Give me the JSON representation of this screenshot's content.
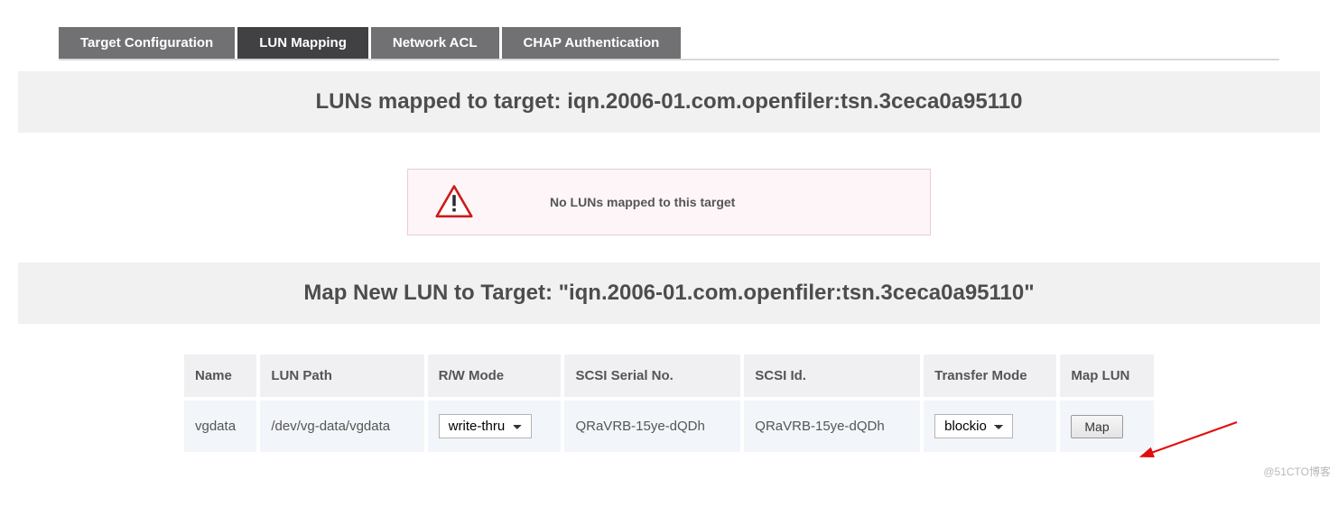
{
  "tabs": [
    {
      "label": "Target Configuration",
      "active": false
    },
    {
      "label": "LUN Mapping",
      "active": true
    },
    {
      "label": "Network ACL",
      "active": false
    },
    {
      "label": "CHAP Authentication",
      "active": false
    }
  ],
  "section1": {
    "title": "LUNs mapped to target: iqn.2006-01.com.openfiler:tsn.3ceca0a95110"
  },
  "notice": {
    "text": "No LUNs mapped to this target"
  },
  "section2": {
    "title": "Map New LUN to Target: \"iqn.2006-01.com.openfiler:tsn.3ceca0a95110\""
  },
  "lun_table": {
    "headers": {
      "name": "Name",
      "lun_path": "LUN Path",
      "rw_mode": "R/W Mode",
      "scsi_serial": "SCSI Serial No.",
      "scsi_id": "SCSI Id.",
      "transfer_mode": "Transfer Mode",
      "map_lun": "Map LUN"
    },
    "row": {
      "name": "vgdata",
      "lun_path": "/dev/vg-data/vgdata",
      "rw_mode": "write-thru",
      "scsi_serial": "QRaVRB-15ye-dQDh",
      "scsi_id": "QRaVRB-15ye-dQDh",
      "transfer_mode": "blockio",
      "map_button": "Map"
    }
  },
  "watermark": "@51CTO博客"
}
